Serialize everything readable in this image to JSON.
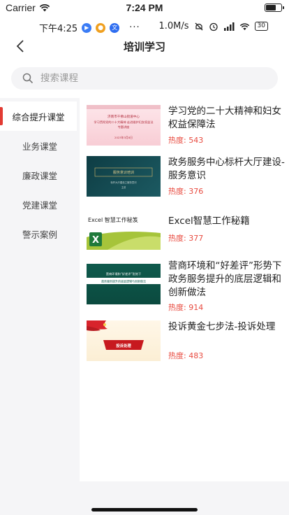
{
  "ios_status": {
    "carrier": "Carrier",
    "time": "7:24 PM"
  },
  "android_status": {
    "time": "下午4:25",
    "dots": "···",
    "speed": "1.0M/s",
    "battery": "30"
  },
  "header": {
    "title": "培训学习"
  },
  "search": {
    "placeholder": "搜索课程"
  },
  "sidebar": {
    "items": [
      {
        "label": "综合提升课堂",
        "active": true
      },
      {
        "label": "业务课堂",
        "active": false
      },
      {
        "label": "廉政课堂",
        "active": false
      },
      {
        "label": "党建课堂",
        "active": false
      },
      {
        "label": "警示案例",
        "active": false
      }
    ]
  },
  "heat_label": "热度:",
  "courses": [
    {
      "title": "学习党的二十大精神和妇女权益保障法",
      "heat": "543",
      "thumb": {
        "l1": "济南市千佛山街道中心",
        "l2": "学习贯彻党的二十大精神 走进维护妇女权益法",
        "l3": "专题讲座",
        "l4": "2023年3月8日"
      }
    },
    {
      "title": "政务服务中心标杆大厅建设-服务意识",
      "heat": "376",
      "thumb": {
        "l1": "服务意识培训",
        "l2": "标杆大厅建设之服务意识",
        "l3": "主讲"
      }
    },
    {
      "title": "Excel智慧工作秘籍",
      "heat": "377",
      "thumb": {
        "l1": "Excel 智慧工作秘笈"
      }
    },
    {
      "title": "营商环境和“好差评”形势下政务服务提升的底层逻辑和创新做法",
      "heat": "914",
      "thumb": {
        "l1": "营商环境和“好差评”形势下",
        "l2": "政务服务提升的底层逻辑与创新做法"
      }
    },
    {
      "title": "投诉黄金七步法-投诉处理",
      "heat": "483",
      "thumb": {
        "l1": "投诉处理"
      }
    }
  ]
}
